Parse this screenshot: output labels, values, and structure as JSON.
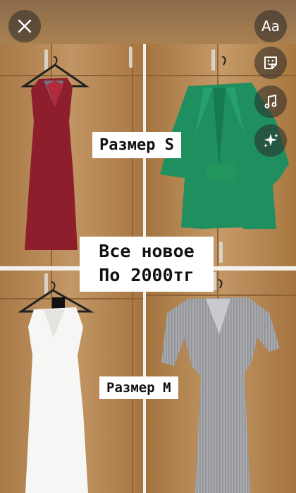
{
  "story": {
    "aa_label": "Aa",
    "overlays": {
      "size_s": "Размер S",
      "main_line1": "Все новое",
      "main_line2": "По 2000тг",
      "size_m": "Размер M"
    }
  },
  "icons": {
    "close": "close-icon",
    "text": "text-tool-icon",
    "sticker": "sticker-icon",
    "music": "music-note-icon",
    "effects": "sparkles-icon",
    "more": "chevron-down-icon"
  },
  "colors": {
    "wardrobe_wood": "#b88a57",
    "burgundy_dress": "#8e1e2c",
    "green_suit": "#1f8f5f",
    "white_dress": "#f6f6f4",
    "silver_dress": "#a7a9ad"
  }
}
